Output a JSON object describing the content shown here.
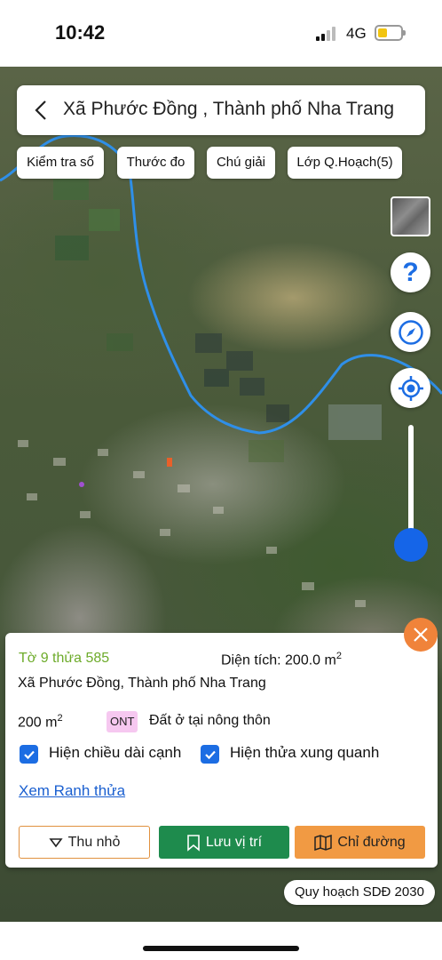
{
  "status_bar": {
    "time": "10:42",
    "network": "4G"
  },
  "header": {
    "title": "Xã Phước Đồng , Thành phố Nha Trang"
  },
  "toolbar": {
    "chips": [
      "Kiểm tra sổ",
      "Thước đo",
      "Chú giải",
      "Lớp Q.Hoạch(5)"
    ]
  },
  "map_controls": {
    "help_label": "?",
    "zoom_level": 0.1
  },
  "info_card": {
    "parcel_id": "Tờ 9 thửa 585",
    "area_label": "Diện tích: 200.0 m",
    "area_sup": "2",
    "address": "Xã Phước Đồng, Thành phố Nha Trang",
    "area_value": "200 m",
    "area_value_sup": "2",
    "land_code": "ONT",
    "land_type": "Đất ở tại nông thôn",
    "checkbox_edges": "Hiện chiều dài cạnh",
    "checkbox_neighbors": "Hiện thửa xung quanh",
    "link_boundary": "Xem Ranh thửa",
    "btn_shrink": "Thu nhỏ",
    "btn_save": "Lưu vị trí",
    "btn_route": "Chỉ đường"
  },
  "plan_label": "Quy hoạch SDĐ 2030",
  "colors": {
    "accent_green": "#1e8b4d",
    "accent_orange": "#f19a43",
    "link_blue": "#1a5fd0",
    "river": "#2f8fe8"
  }
}
